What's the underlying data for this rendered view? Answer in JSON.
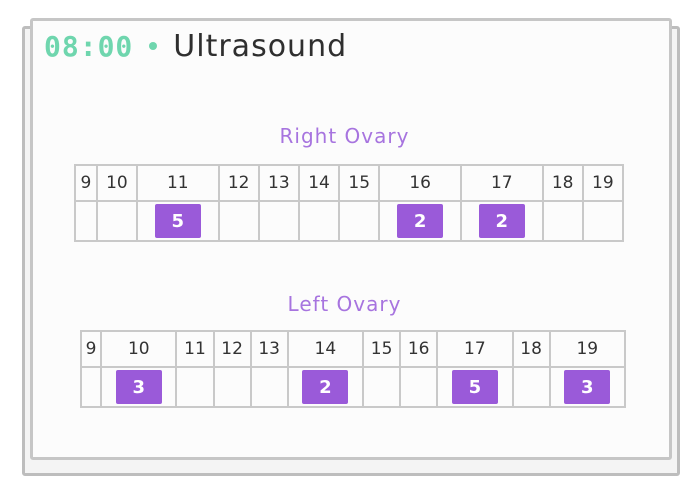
{
  "header": {
    "time": "08:00",
    "title": "Ultrasound",
    "accent_color": "#6fd6ae"
  },
  "ovaries": [
    {
      "label": "Right Ovary",
      "days": [
        "9",
        "10",
        "11",
        "12",
        "13",
        "14",
        "15",
        "16",
        "17",
        "18",
        "19"
      ],
      "counts": [
        "",
        "",
        "5",
        "",
        "",
        "",
        "",
        "2",
        "2",
        "",
        ""
      ]
    },
    {
      "label": "Left Ovary",
      "days": [
        "9",
        "10",
        "11",
        "12",
        "13",
        "14",
        "15",
        "16",
        "17",
        "18",
        "19"
      ],
      "counts": [
        "",
        "3",
        "",
        "",
        "",
        "2",
        "",
        "",
        "5",
        "",
        "3"
      ]
    }
  ],
  "badge_color": "#9a5ad9"
}
